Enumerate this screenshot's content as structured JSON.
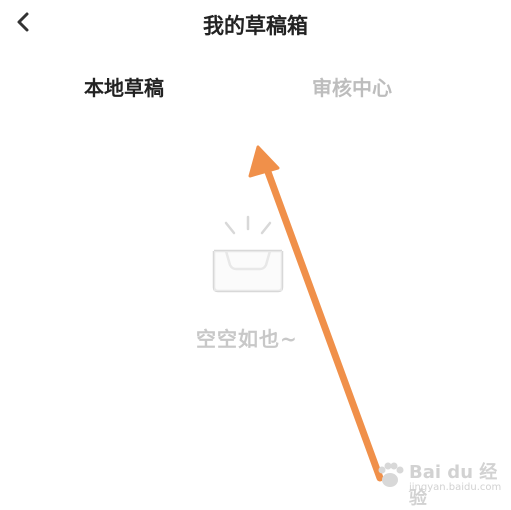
{
  "header": {
    "back_icon": "chevron-left-icon",
    "title": "我的草稿箱"
  },
  "tabs": [
    {
      "label": "本地草稿",
      "active": true
    },
    {
      "label": "审核中心",
      "active": false
    }
  ],
  "empty_state": {
    "icon": "empty-inbox-icon",
    "message": "空空如也~"
  },
  "annotation": {
    "type": "arrow",
    "color": "#f0904a"
  },
  "watermark": {
    "brand": "Bai du 经验",
    "url": "jingyan.baidu.com"
  },
  "colors": {
    "title": "#222222",
    "tab_active": "#222222",
    "tab_inactive": "#bdbdbd",
    "empty": "#c8c8c8",
    "arrow": "#f0904a"
  }
}
